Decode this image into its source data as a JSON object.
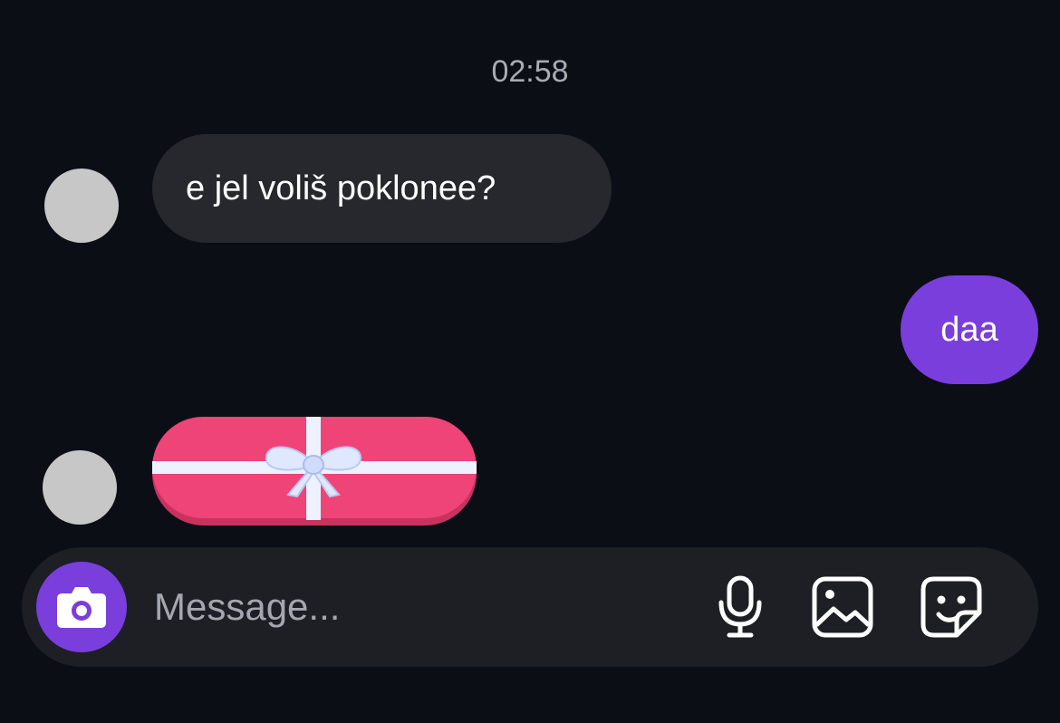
{
  "chat": {
    "timestamp": "02:58",
    "messages": [
      {
        "direction": "incoming",
        "type": "text",
        "text": "e jel voliš poklonee?"
      },
      {
        "direction": "outgoing",
        "type": "text",
        "text": "daa"
      },
      {
        "direction": "incoming",
        "type": "sticker",
        "sticker": "gift-box"
      }
    ]
  },
  "composer": {
    "placeholder": "Message...",
    "value": "",
    "buttons": [
      "camera-icon",
      "microphone-icon",
      "gallery-icon",
      "sticker-icon"
    ]
  },
  "colors": {
    "background": "#0c0e16",
    "incoming_bubble": "#26282d",
    "outgoing_bubble": "#7a3edc",
    "accent": "#7a3edc",
    "composer_bg": "#1d1f24",
    "avatar_placeholder": "#c7c7c7",
    "gift_pink": "#ef4478",
    "ribbon": "#f2f4ff"
  }
}
